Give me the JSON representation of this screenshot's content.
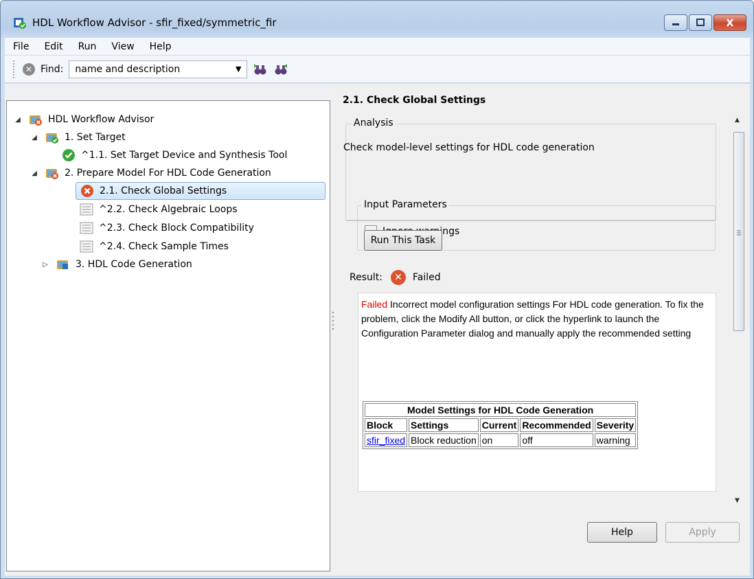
{
  "window": {
    "title": "HDL Workflow Advisor - sfir_fixed/symmetric_fir",
    "controls": [
      "minimize",
      "maximize",
      "close"
    ]
  },
  "menu": [
    "File",
    "Edit",
    "Run",
    "View",
    "Help"
  ],
  "toolbar": {
    "find_label": "Find:",
    "find_value": "name and description"
  },
  "tree": [
    {
      "label": "HDL Workflow Advisor",
      "icon": "folder-error-icon",
      "expander": "expanded"
    },
    {
      "label": "1. Set Target",
      "icon": "folder-pass-icon",
      "expander": "expanded"
    },
    {
      "label": "^1.1. Set Target Device and Synthesis Tool",
      "icon": "check-pass-icon",
      "expander": "none"
    },
    {
      "label": "2. Prepare Model For HDL Code Generation",
      "icon": "folder-error-icon",
      "expander": "expanded"
    },
    {
      "label": "2.1. Check Global Settings",
      "icon": "fail-icon",
      "expander": "none",
      "selected": true
    },
    {
      "label": "^2.2. Check Algebraic Loops",
      "icon": "task-icon",
      "expander": "none"
    },
    {
      "label": "^2.3. Check Block Compatibility",
      "icon": "task-icon",
      "expander": "none"
    },
    {
      "label": "^2.4. Check Sample Times",
      "icon": "task-icon",
      "expander": "none"
    },
    {
      "label": "3. HDL Code Generation",
      "icon": "folder-icon",
      "expander": "collapsed"
    }
  ],
  "panel": {
    "title": "2.1. Check Global Settings",
    "analysis_legend": "Analysis",
    "analysis_text": "Check model-level settings for HDL code generation",
    "input_params_legend": "Input Parameters",
    "ignore_warnings_label": "Ignore warnings",
    "run_button": "Run This Task",
    "result_label": "Result:",
    "result_status": "Failed",
    "message_failed": "Failed",
    "message_text": " Incorrect model configuration settings For HDL code generation. To fix the problem, click the Modify All button, or click the hyperlink to launch the Configuration Parameter dialog and manually apply the recommended setting",
    "table": {
      "caption": "Model Settings for HDL Code Generation",
      "headers": [
        "Block",
        "Settings",
        "Current",
        "Recommended",
        "Severity"
      ],
      "rows": [
        [
          "sfir_fixed",
          "Block reduction",
          "on",
          "off",
          "warning"
        ]
      ]
    }
  },
  "buttons": {
    "help": "Help",
    "apply": "Apply"
  }
}
